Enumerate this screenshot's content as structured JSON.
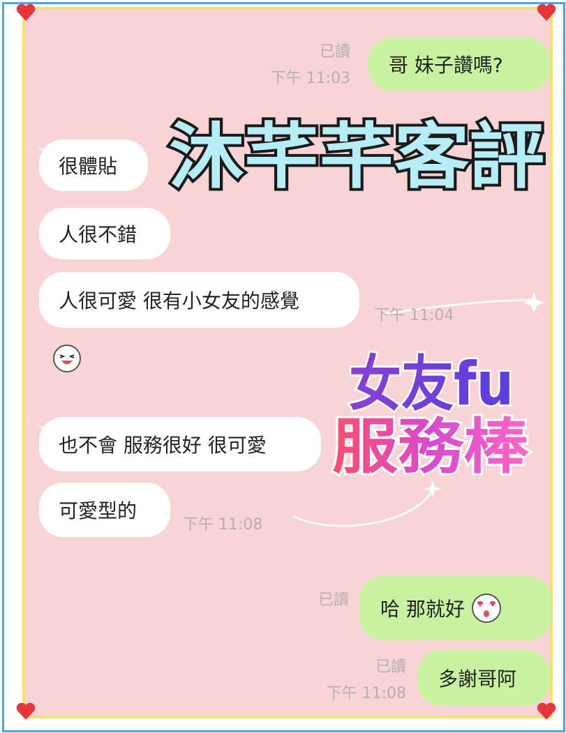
{
  "colors": {
    "outer_border": "#4aa6dc",
    "panel_bg": "#f8d4d6",
    "panel_border": "#f4e267",
    "incoming_bubble": "#ffffff",
    "outgoing_bubble": "#c9f2a0",
    "meta_text": "#b7b0b0",
    "heart": "#e8353b",
    "title_fill": "#b6eef8"
  },
  "title": "沐芊芊客評",
  "badge": {
    "line1": "女友fu",
    "line2": "服務棒"
  },
  "messages": [
    {
      "side": "out",
      "text": "哥  妹子讚嗎?",
      "read": "已讀",
      "time": "下午 11:03"
    },
    {
      "side": "in",
      "text": "很體貼"
    },
    {
      "side": "in",
      "text": "人很不錯"
    },
    {
      "side": "in",
      "text": "人很可愛 很有小女友的感覺",
      "time": "下午 11:04"
    },
    {
      "side": "in",
      "sticker": "laughing-face-emoji"
    },
    {
      "side": "in",
      "text": "也不會 服務很好 很可愛"
    },
    {
      "side": "in",
      "text": "可愛型的",
      "time": "下午 11:08"
    },
    {
      "side": "out",
      "text": "哈  那就好",
      "sticker": "heart-eyes-face-emoji",
      "read": "已讀"
    },
    {
      "side": "out",
      "text": "多謝哥阿",
      "read": "已讀",
      "time": "下午 11:08"
    }
  ]
}
